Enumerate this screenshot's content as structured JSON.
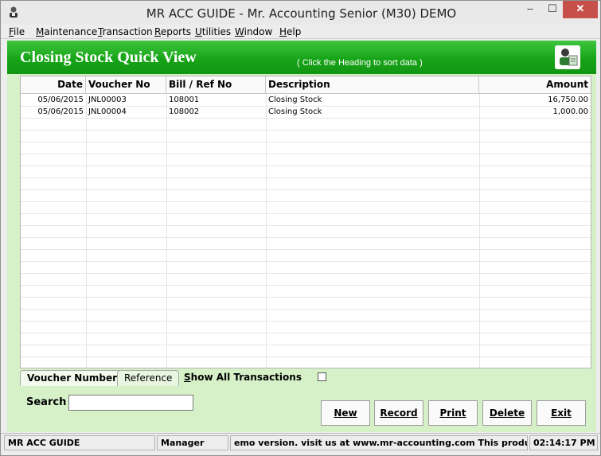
{
  "window": {
    "title": "MR ACC GUIDE - Mr. Accounting Senior (M30) DEMO",
    "minimize": "–",
    "maximize": "☐",
    "close": "✕"
  },
  "menu": {
    "items": [
      {
        "first": "F",
        "rest": "ile"
      },
      {
        "first": "M",
        "rest": "aintenance"
      },
      {
        "first": "T",
        "rest": "ransaction"
      },
      {
        "first": "R",
        "rest": "eports"
      },
      {
        "first": "U",
        "rest": "tilities"
      },
      {
        "first": "W",
        "rest": "indow"
      },
      {
        "first": "H",
        "rest": "elp"
      }
    ]
  },
  "header": {
    "title": "Closing Stock Quick View",
    "hint": "( Click the Heading to sort data )",
    "icon": "accountant-icon"
  },
  "table": {
    "columns": [
      "Date",
      "Voucher No",
      "Bill / Ref No",
      "Description",
      "Amount"
    ],
    "rows": [
      {
        "date": "05/06/2015",
        "voucher": "JNL00003",
        "ref": "108001",
        "description": "Closing Stock",
        "amount": "16,750.00"
      },
      {
        "date": "05/06/2015",
        "voucher": "JNL00004",
        "ref": "108002",
        "description": "Closing Stock",
        "amount": "1,000.00"
      }
    ]
  },
  "tabs": {
    "voucher_number": "Voucher Number",
    "reference": "Reference"
  },
  "show_all": {
    "first": "S",
    "rest": "how All Transactions",
    "checked": false
  },
  "search": {
    "label": "Search",
    "value": ""
  },
  "buttons": {
    "new": "New",
    "record": "Record",
    "print": "Print",
    "delete": "Delete",
    "exit": "Exit"
  },
  "status": {
    "app": "MR ACC GUIDE",
    "user": "Manager",
    "message": "emo version.  visit us at www.mr-accounting.com This product is d",
    "time": "02:14:17 PM"
  },
  "colors": {
    "header_green": "#18a418",
    "content_bg": "#d6f0c8",
    "close_red": "#c7504b"
  }
}
